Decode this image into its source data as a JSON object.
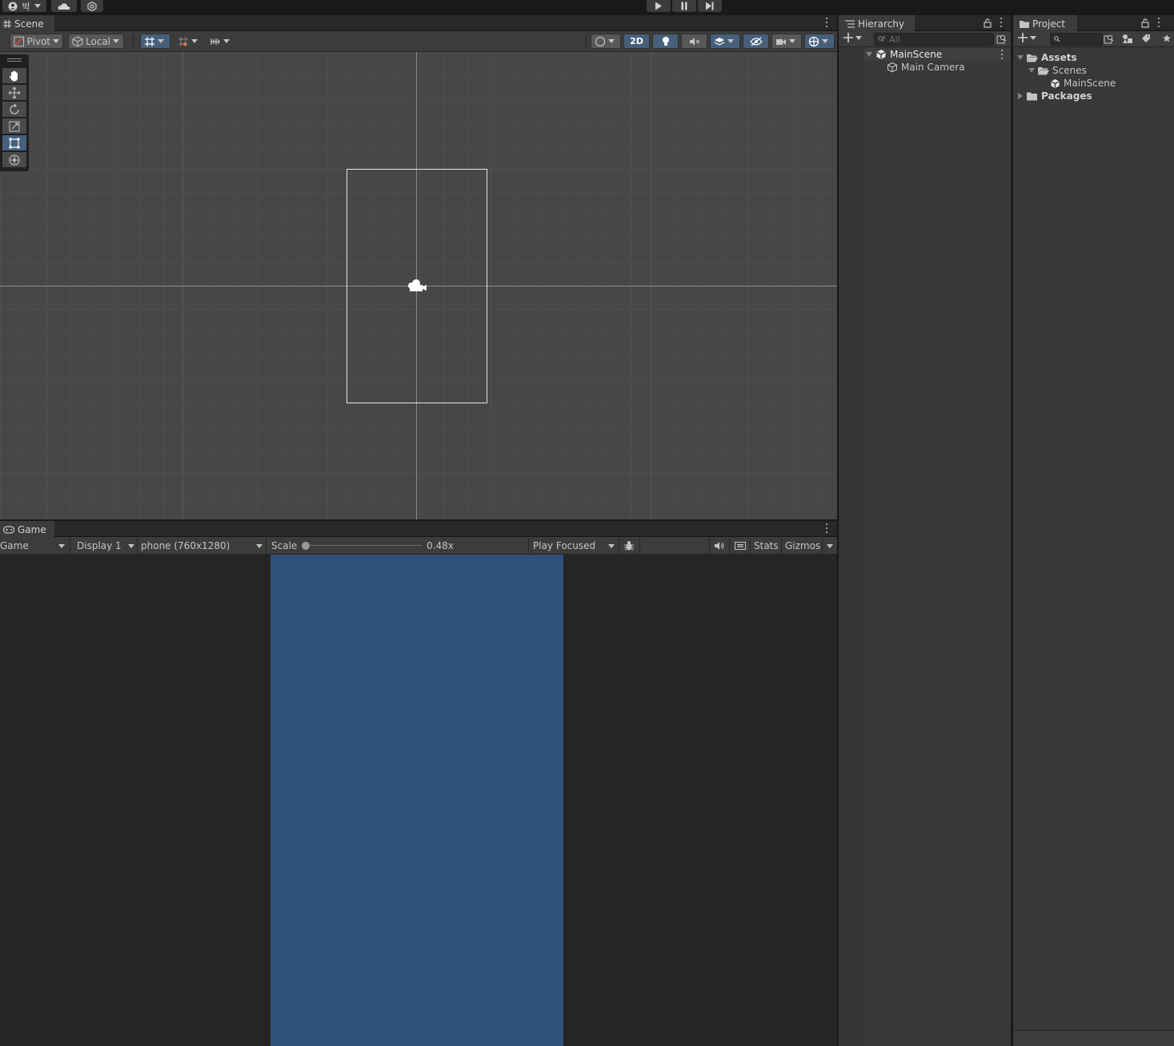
{
  "topbar": {
    "account_label": "박",
    "play_controls": [
      "play",
      "pause",
      "step"
    ]
  },
  "scene": {
    "tab_label": "Scene",
    "pivot_label": "Pivot",
    "local_label": "Local",
    "mode_2d_label": "2D"
  },
  "hierarchy": {
    "tab_label": "Hierarchy",
    "search_placeholder": "All",
    "scene_name": "MainScene",
    "items": [
      "Main Camera"
    ]
  },
  "project": {
    "tab_label": "Project",
    "tree": {
      "assets": "Assets",
      "scenes": "Scenes",
      "main_scene": "MainScene",
      "packages": "Packages"
    }
  },
  "game": {
    "tab_label": "Game",
    "view_mode": "Game",
    "display": "Display 1",
    "resolution": "phone (760x1280)",
    "scale_label": "Scale",
    "scale_value": "0.48x",
    "scale_fraction": 0.0,
    "play_mode": "Play Focused",
    "stats_label": "Stats",
    "gizmos_label": "Gizmos",
    "camera_background": "#30507c"
  },
  "colors": {
    "editor_bg": "#191919",
    "panel_bg": "#383838",
    "accent_blue": "#46607c"
  }
}
